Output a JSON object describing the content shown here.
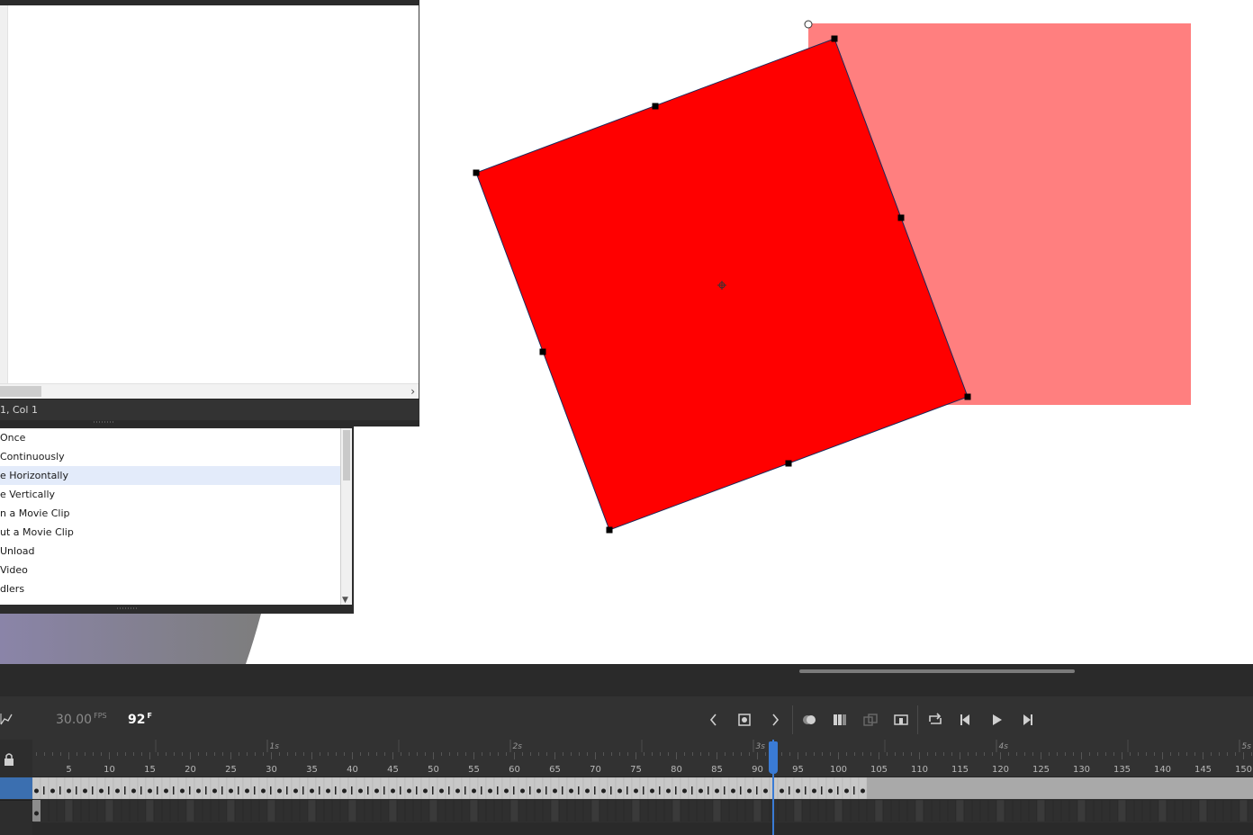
{
  "stage": {
    "shape_fill": "#ff0000",
    "ghost_fill": "#ff7f7f",
    "outline": "#1a2a5a"
  },
  "code_panel": {
    "status": "1, Col 1",
    "scroll_right_icon": "chevron-right-icon"
  },
  "snippets": {
    "items": [
      {
        "label": " Once"
      },
      {
        "label": " Continuously"
      },
      {
        "label": "e Horizontally"
      },
      {
        "label": "e Vertically"
      },
      {
        "label": "n a Movie Clip"
      },
      {
        "label": "ut a Movie Clip"
      },
      {
        "label": " Unload"
      },
      {
        "label": " Video"
      },
      {
        "label": "dlers"
      }
    ],
    "selected_index": 2
  },
  "timeline": {
    "fps_value": "30.00",
    "fps_unit": "FPS",
    "frame_value": "92",
    "frame_unit": "F",
    "current_frame": 92,
    "accent": "#3a7bd5",
    "ruler_seconds": [
      "1s",
      "2s",
      "3s",
      "4s",
      "5s"
    ],
    "ruler_frames": [
      "5",
      "10",
      "15",
      "20",
      "25",
      "30",
      "35",
      "40",
      "45",
      "50",
      "55",
      "60",
      "65",
      "70",
      "75",
      "80",
      "85",
      "90",
      "95",
      "100",
      "105",
      "110",
      "115",
      "120",
      "125",
      "130",
      "135",
      "140",
      "145",
      "150"
    ],
    "buttons": [
      {
        "name": "prev-keyframe-button",
        "icon": "chevron-left-icon"
      },
      {
        "name": "insert-keyframe-button",
        "icon": "keyframe-icon"
      },
      {
        "name": "next-keyframe-button",
        "icon": "chevron-right-icon"
      },
      {
        "name": "onion-skin-button",
        "icon": "onion-skin-icon"
      },
      {
        "name": "edit-multiple-frames-button",
        "icon": "multi-frame-icon"
      },
      {
        "name": "onion-outlines-button",
        "icon": "onion-outline-icon"
      },
      {
        "name": "center-frame-button",
        "icon": "center-frame-icon"
      },
      {
        "name": "loop-button",
        "icon": "loop-icon"
      },
      {
        "name": "step-back-button",
        "icon": "step-back-icon"
      },
      {
        "name": "play-button",
        "icon": "play-icon"
      },
      {
        "name": "step-forward-button",
        "icon": "step-forward-icon"
      }
    ]
  }
}
